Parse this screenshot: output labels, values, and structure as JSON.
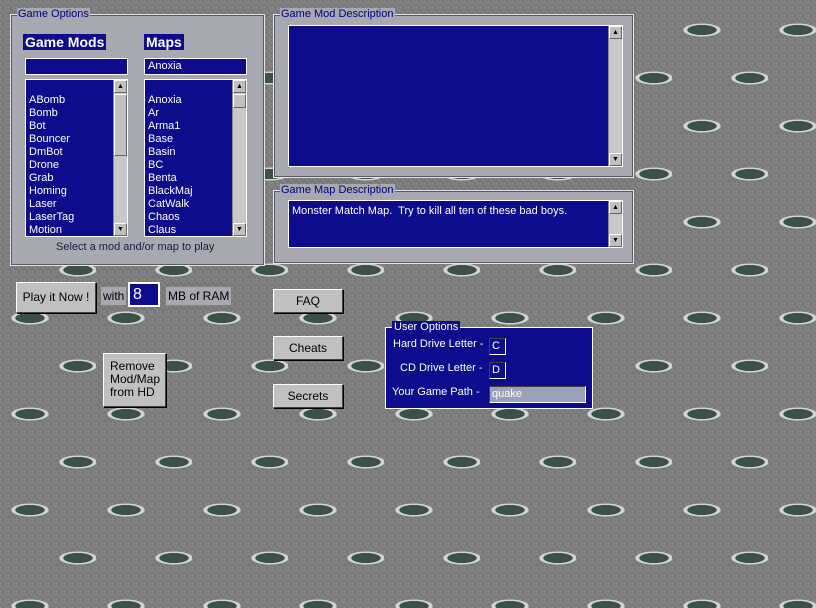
{
  "game_options": {
    "title": "Game Options",
    "mods_header": "Game Mods",
    "maps_header": "Maps",
    "mod_filter_value": "",
    "map_filter_value": "Anoxia",
    "mods": [
      "ABomb",
      "Bomb",
      "Bot",
      "Bouncer",
      "DmBot",
      "Drone",
      "Grab",
      "Homing",
      "Laser",
      "LaserTag",
      "Motion"
    ],
    "maps": [
      "Anoxia",
      "Ar",
      "Arma1",
      "Base",
      "Basin",
      "BC",
      "Benta",
      "BlackMaj",
      "CatWalk",
      "Chaos",
      "Claus"
    ],
    "selected_map": "Anoxia",
    "hint": "Select a mod and/or map to play"
  },
  "mod_description": {
    "title": "Game Mod Description",
    "text": ""
  },
  "map_description": {
    "title": "Game Map Description",
    "text": "Monster Match Map.  Try to kill all ten of these bad boys."
  },
  "play": {
    "button": "Play it Now !",
    "with": "with",
    "ram_value": "8",
    "ram_unit": "MB of RAM"
  },
  "remove_button": [
    "Remove",
    "Mod/Map",
    "from HD"
  ],
  "buttons": {
    "faq": "FAQ",
    "cheats": "Cheats",
    "secrets": "Secrets"
  },
  "user_options": {
    "title": "User Options",
    "hard_drive_label": "Hard Drive Letter -",
    "hard_drive_value": "C",
    "cd_drive_label": "CD Drive Letter -",
    "cd_drive_value": "D",
    "game_path_label": "Your Game Path  -",
    "game_path_value": "quake"
  },
  "colors": {
    "panel_navy": "#0c0c8c",
    "panel_gray": "#a8a8b0",
    "title_text": "#000080"
  }
}
